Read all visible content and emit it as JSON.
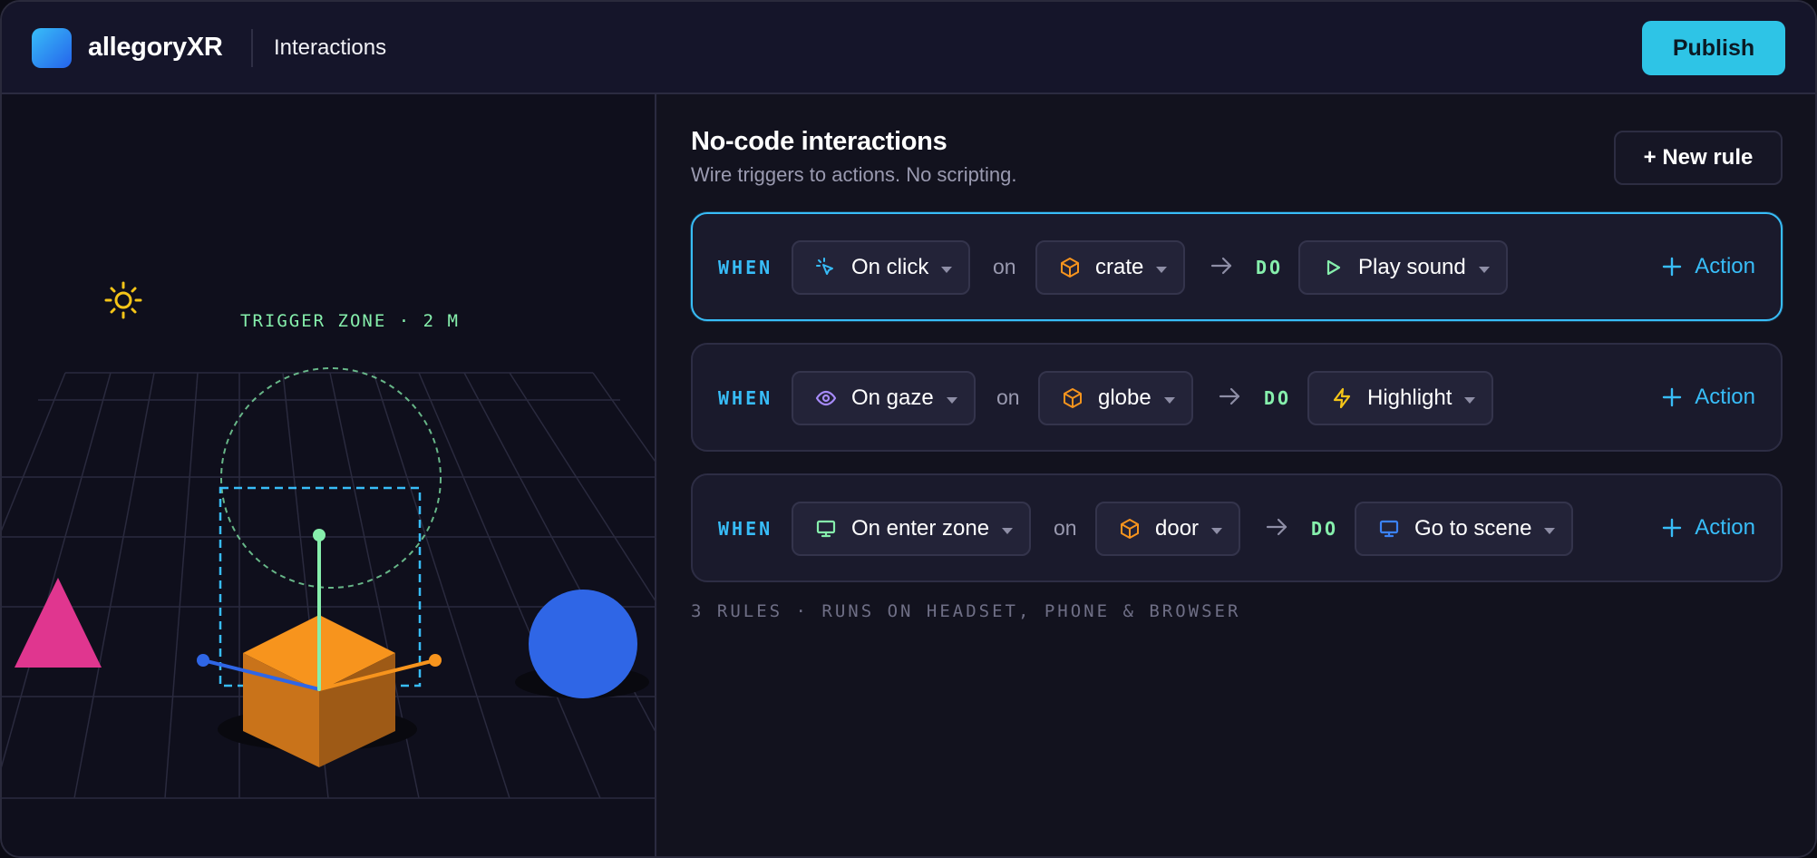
{
  "header": {
    "brand": "allegoryXR",
    "page_title": "Interactions",
    "publish_label": "Publish",
    "brand_color": "#2ec4e6"
  },
  "viewport": {
    "trigger_zone_label": "TRIGGER ZONE · 2 M",
    "icons": [
      "sun-icon",
      "move-gizmo"
    ],
    "objects": [
      "crate",
      "globe",
      "cone"
    ]
  },
  "panel": {
    "title": "No-code interactions",
    "subtitle": "Wire triggers to actions. No scripting.",
    "new_rule_label": "+ New rule",
    "when_label": "WHEN",
    "on_label": "on",
    "do_label": "DO",
    "add_action_label": "Action",
    "rules": [
      {
        "trigger": "On click",
        "trigger_icon": "cursor-click-icon",
        "target": "crate",
        "target_icon": "cube-icon",
        "action": "Play sound",
        "action_icon": "play-icon",
        "active": true
      },
      {
        "trigger": "On gaze",
        "trigger_icon": "eye-icon",
        "target": "globe",
        "target_icon": "cube-icon",
        "action": "Highlight",
        "action_icon": "lightning-icon",
        "active": false
      },
      {
        "trigger": "On enter zone",
        "trigger_icon": "monitor-icon",
        "target": "door",
        "target_icon": "cube-icon",
        "action": "Go to scene",
        "action_icon": "monitor-icon",
        "active": false
      }
    ],
    "footer": "3 RULES · RUNS ON HEADSET, PHONE & BROWSER"
  },
  "colors": {
    "accent": "#38bdf8",
    "do_green": "#86efac",
    "crate_orange": "#f7941d",
    "globe_blue": "#2f66e6",
    "cone_pink": "#e0368f",
    "sun_yellow": "#f5c518"
  }
}
